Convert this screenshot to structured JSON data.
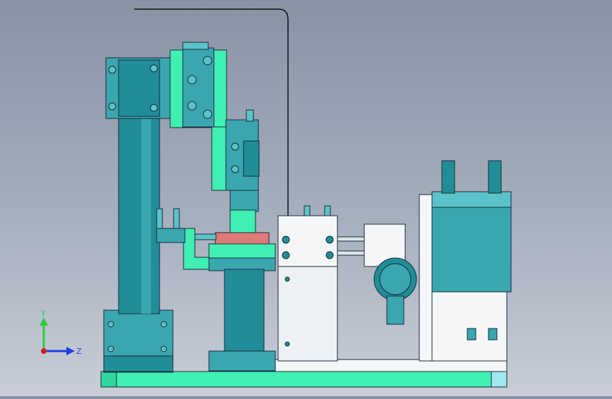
{
  "viewport": {
    "colors": {
      "background_top": "#8793a5",
      "background_bottom": "#c9ced8",
      "teal_dark": "#1f8e98",
      "teal": "#3aa6b0",
      "teal_light": "#5cc2c9",
      "mint": "#3ff0b2",
      "mint_dark": "#2fd69d",
      "white_part": "#f4f6f8",
      "pink": "#e07a78",
      "outline": "#1b2a36",
      "cyan_block": "#9fe8f0"
    },
    "view_mode": "shaded-with-edges"
  },
  "triad": {
    "y_label": "Y",
    "z_label": "Z",
    "y_color": "#2ecc40",
    "z_color": "#1f3ce0",
    "origin_color": "#d01c1c"
  }
}
